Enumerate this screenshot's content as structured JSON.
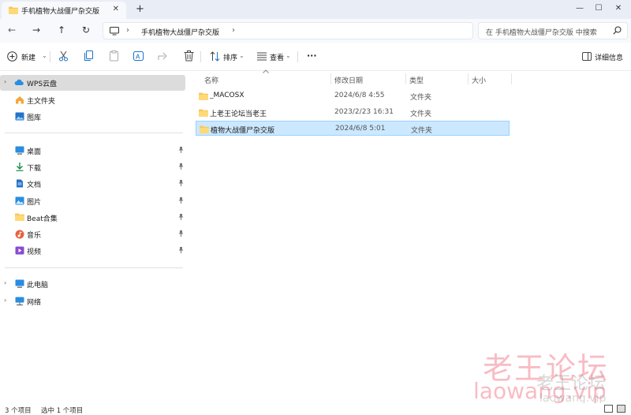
{
  "titlebar": {
    "tab_title": "手机植物大战僵尸杂交版",
    "close_tab": "✕",
    "new_tab": "+",
    "minimize": "—",
    "maximize": "☐",
    "close": "✕"
  },
  "address": {
    "back": "←",
    "forward": "→",
    "up": "↑",
    "refresh": "↻",
    "separator": "›",
    "crumb": "手机植物大战僵尸杂交版",
    "search_placeholder": "在 手机植物大战僵尸杂交版 中搜索"
  },
  "toolbar": {
    "new_label": "新建",
    "sort_label": "排序",
    "view_label": "查看",
    "more_label": "···",
    "details_label": "详细信息",
    "chevron": "⌄"
  },
  "sidebar": {
    "items": [
      {
        "label": "WPS云盘",
        "icon": "cloud-icon"
      },
      {
        "label": "主文件夹",
        "icon": "home-icon"
      },
      {
        "label": "图库",
        "icon": "gallery-icon"
      },
      {
        "label": "桌面",
        "icon": "desktop-icon"
      },
      {
        "label": "下载",
        "icon": "download-icon"
      },
      {
        "label": "文档",
        "icon": "document-icon"
      },
      {
        "label": "图片",
        "icon": "pictures-icon"
      },
      {
        "label": "Beat合集",
        "icon": "folder-icon"
      },
      {
        "label": "音乐",
        "icon": "music-icon"
      },
      {
        "label": "视频",
        "icon": "video-icon"
      },
      {
        "label": "此电脑",
        "icon": "computer-icon"
      },
      {
        "label": "网络",
        "icon": "network-icon"
      }
    ],
    "expand": "›",
    "pin": "📌"
  },
  "columns": {
    "name": "名称",
    "date": "修改日期",
    "type": "类型",
    "size": "大小"
  },
  "files": [
    {
      "name": "_MACOSX",
      "date": "2024/6/8 4:55",
      "type": "文件夹"
    },
    {
      "name": "上老王论坛当老王",
      "date": "2023/2/23 16:31",
      "type": "文件夹"
    },
    {
      "name": "植物大战僵尸杂交版",
      "date": "2024/6/8 5:01",
      "type": "文件夹"
    }
  ],
  "status": {
    "count": "3 个项目",
    "selected": "选中 1 个项目"
  },
  "watermark": {
    "cn": "老王论坛",
    "en": "laowang.vip"
  },
  "colors": {
    "accent": "#0067c0",
    "selection": "#cce8ff",
    "folder": "#f8c75a"
  }
}
